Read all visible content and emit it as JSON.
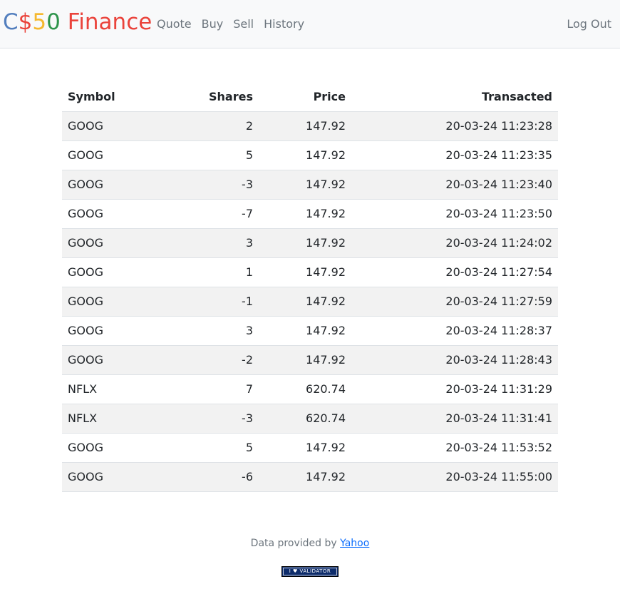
{
  "navbar": {
    "brand": {
      "c": "C",
      "dollar": "$",
      "five": "5",
      "zero": "0",
      "finance": "Finance"
    },
    "links": [
      "Quote",
      "Buy",
      "Sell",
      "History"
    ],
    "logout": "Log Out"
  },
  "table": {
    "headers": {
      "symbol": "Symbol",
      "shares": "Shares",
      "price": "Price",
      "transacted": "Transacted"
    },
    "rows": [
      {
        "symbol": "GOOG",
        "shares": "2",
        "price": "147.92",
        "transacted": "20-03-24 11:23:28"
      },
      {
        "symbol": "GOOG",
        "shares": "5",
        "price": "147.92",
        "transacted": "20-03-24 11:23:35"
      },
      {
        "symbol": "GOOG",
        "shares": "-3",
        "price": "147.92",
        "transacted": "20-03-24 11:23:40"
      },
      {
        "symbol": "GOOG",
        "shares": "-7",
        "price": "147.92",
        "transacted": "20-03-24 11:23:50"
      },
      {
        "symbol": "GOOG",
        "shares": "3",
        "price": "147.92",
        "transacted": "20-03-24 11:24:02"
      },
      {
        "symbol": "GOOG",
        "shares": "1",
        "price": "147.92",
        "transacted": "20-03-24 11:27:54"
      },
      {
        "symbol": "GOOG",
        "shares": "-1",
        "price": "147.92",
        "transacted": "20-03-24 11:27:59"
      },
      {
        "symbol": "GOOG",
        "shares": "3",
        "price": "147.92",
        "transacted": "20-03-24 11:28:37"
      },
      {
        "symbol": "GOOG",
        "shares": "-2",
        "price": "147.92",
        "transacted": "20-03-24 11:28:43"
      },
      {
        "symbol": "NFLX",
        "shares": "7",
        "price": "620.74",
        "transacted": "20-03-24 11:31:29"
      },
      {
        "symbol": "NFLX",
        "shares": "-3",
        "price": "620.74",
        "transacted": "20-03-24 11:31:41"
      },
      {
        "symbol": "GOOG",
        "shares": "5",
        "price": "147.92",
        "transacted": "20-03-24 11:53:52"
      },
      {
        "symbol": "GOOG",
        "shares": "-6",
        "price": "147.92",
        "transacted": "20-03-24 11:55:00"
      }
    ]
  },
  "footer": {
    "text": "Data provided by",
    "link": "Yahoo",
    "validator": {
      "i": "I",
      "heart": "♥",
      "label": "VALIDATOR"
    }
  },
  "colors": {
    "brand_blue": "#537fbe",
    "brand_red": "#ea433b",
    "brand_yellow": "#f5b82e",
    "brand_green": "#2e944b",
    "navbar_bg": "#f8f9fa",
    "stripe": "#f2f2f2",
    "link": "#0d6efd"
  }
}
